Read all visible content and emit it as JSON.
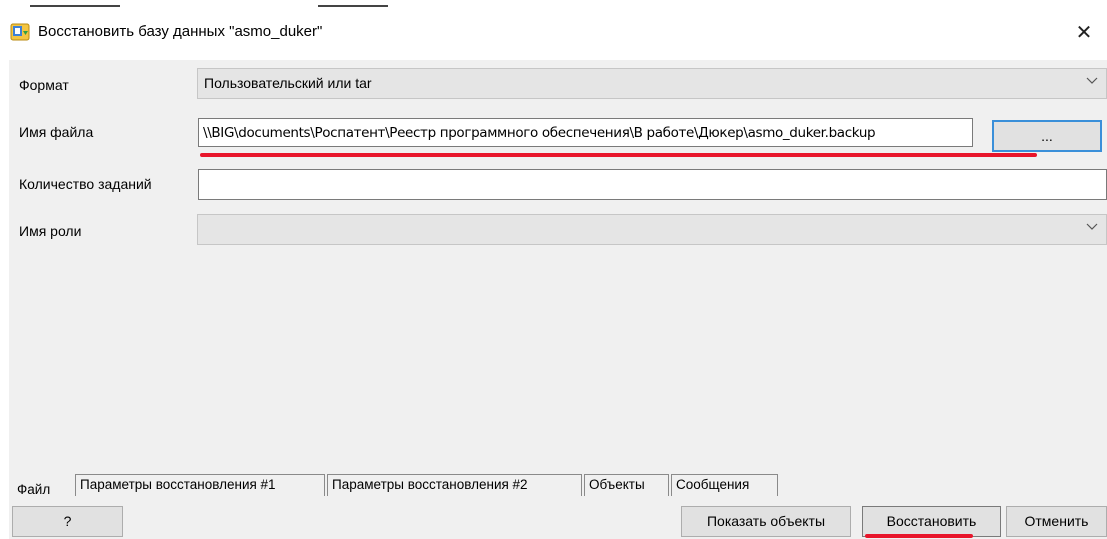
{
  "dialog": {
    "title": "Восстановить базу данных \"asmo_duker\"",
    "close_symbol": "✕"
  },
  "form": {
    "format_label": "Формат",
    "format_value": "Пользовательский или tar",
    "filename_label": "Имя файла",
    "filename_value": "\\\\BIG\\documents\\Роспатент\\Реестр программного обеспечения\\В работе\\Дюкер\\asmo_duker.backup",
    "browse_label": "...",
    "jobs_label": "Количество заданий",
    "jobs_value": "",
    "role_label": "Имя роли",
    "role_value": ""
  },
  "tabs": [
    {
      "label": "Файл",
      "active": true
    },
    {
      "label": "Параметры восстановления #1",
      "active": false
    },
    {
      "label": "Параметры восстановления #2",
      "active": false
    },
    {
      "label": "Объекты",
      "active": false
    },
    {
      "label": "Сообщения",
      "active": false
    }
  ],
  "buttons": {
    "help": "?",
    "show_objects": "Показать объекты",
    "restore": "Восстановить",
    "cancel": "Отменить"
  },
  "colors": {
    "highlight": "#e8152b",
    "focus_border": "#3a8fd9",
    "dialog_bg": "#f0f0f0"
  },
  "icons": {
    "title": "database-restore-icon",
    "combo": "chevron-down-icon"
  }
}
